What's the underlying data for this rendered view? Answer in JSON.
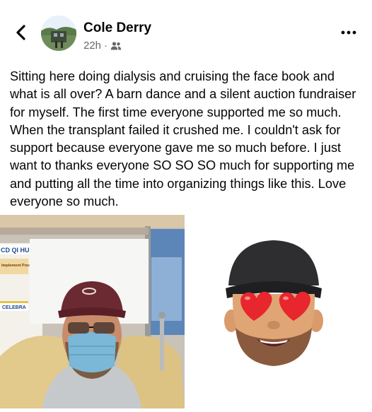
{
  "post": {
    "author": "Cole Derry",
    "timestamp": "22h",
    "separator": "·",
    "audience_icon": "friends-icon",
    "text": "Sitting here doing dialysis and cruising the face book and what is all over? A barn dance and a silent auction fundraiser for myself. The first time everyone supported me so much. When the transplant failed it crushed me. I couldn't ask for support because everyone gave me so much before. I just want to thanks everyone SO SO SO much for supporting me and putting all the time into organizing things like this. Love everyone so much."
  },
  "nav": {
    "back_icon": "chevron-left-icon",
    "more_icon": "more-horizontal-icon"
  },
  "photo_left": {
    "sign_top": "CD QI HU",
    "sign_mid": "Implement Possible",
    "sign_bottom": "CELEBRA"
  },
  "colors": {
    "name": "#050505",
    "meta": "#65676b",
    "background": "#ffffff"
  }
}
